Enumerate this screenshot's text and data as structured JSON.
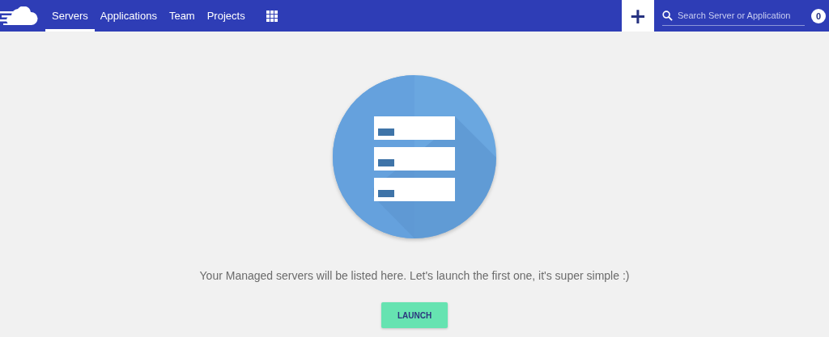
{
  "nav": {
    "items": [
      {
        "label": "Servers",
        "selected": true
      },
      {
        "label": "Applications",
        "selected": false
      },
      {
        "label": "Team",
        "selected": false
      },
      {
        "label": "Projects",
        "selected": false
      }
    ]
  },
  "search": {
    "placeholder": "Search Server or Application",
    "badge": "0"
  },
  "add_button": "+",
  "empty_state": {
    "message": "Your Managed servers will be listed here. Let's launch the first one, it's super simple :)",
    "button": "LAUNCH"
  }
}
